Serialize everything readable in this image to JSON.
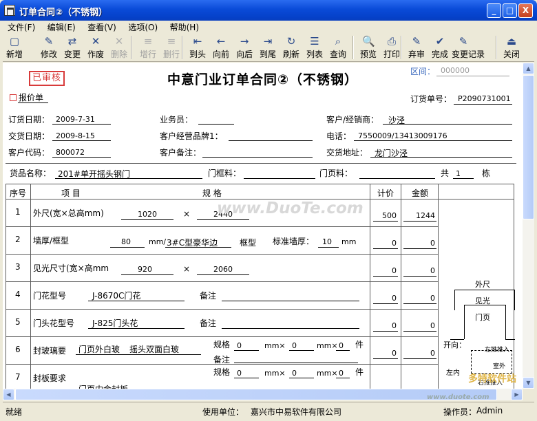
{
  "window": {
    "title": "订单合同②（不锈钢）",
    "min": "_",
    "max": "□",
    "close": "X"
  },
  "menu": [
    "文件(F)",
    "编辑(E)",
    "查看(V)",
    "选项(O)",
    "帮助(H)"
  ],
  "toolbar": [
    {
      "label": "新增",
      "icon": "new-doc-icon",
      "enabled": true
    },
    {
      "label": "修改",
      "icon": "edit-icon",
      "enabled": true
    },
    {
      "label": "变更",
      "icon": "change-icon",
      "enabled": true
    },
    {
      "label": "作废",
      "icon": "void-icon",
      "enabled": true
    },
    {
      "label": "删除",
      "icon": "delete-icon",
      "enabled": false
    },
    {
      "label": "增行",
      "icon": "add-row-icon",
      "enabled": false
    },
    {
      "label": "删行",
      "icon": "delete-row-icon",
      "enabled": false
    },
    {
      "label": "到头",
      "icon": "first-icon",
      "enabled": true
    },
    {
      "label": "向前",
      "icon": "prev-icon",
      "enabled": true
    },
    {
      "label": "向后",
      "icon": "next-icon",
      "enabled": true
    },
    {
      "label": "到尾",
      "icon": "last-icon",
      "enabled": true
    },
    {
      "label": "刷新",
      "icon": "refresh-icon",
      "enabled": true
    },
    {
      "label": "列表",
      "icon": "list-icon",
      "enabled": true
    },
    {
      "label": "查询",
      "icon": "search-icon",
      "enabled": true
    },
    {
      "label": "预览",
      "icon": "preview-icon",
      "enabled": true
    },
    {
      "label": "打印",
      "icon": "print-icon",
      "enabled": true
    },
    {
      "label": "弃审",
      "icon": "unapprove-icon",
      "enabled": true
    },
    {
      "label": "完成",
      "icon": "complete-icon",
      "enabled": true
    },
    {
      "label": "变更记录",
      "icon": "change-log-icon",
      "enabled": true
    },
    {
      "label": "关闭",
      "icon": "exit-icon",
      "enabled": true
    }
  ],
  "doc": {
    "stamp": "已审核",
    "title": "中意门业订单合同②（不锈钢）",
    "quote_label": "报价单",
    "area_label": "区间：",
    "area_value": "000000",
    "order_no_label": "订货单号：",
    "order_no": "P2090731001",
    "order_date_label": "订货日期：",
    "order_date": "2009-7-31",
    "delivery_date_label": "交货日期：",
    "delivery_date": "2009-8-15",
    "customer_code_label": "客户代码：",
    "customer_code": "800072",
    "salesman_label": "业务员：",
    "salesman": "",
    "brand_label": "客户经营品牌1：",
    "brand": "",
    "cust_note_label": "客户备注：",
    "cust_note": "",
    "customer_label": "客户/经销商：",
    "customer": "沙泾",
    "phone_label": "电话：",
    "phone": "7550009/13413009176",
    "address_label": "交货地址：",
    "address": "龙门沙泾",
    "goods_label": "货品名称：",
    "goods": "201#单开摇头钢门",
    "frame_material_label": "门框料：",
    "door_panel_label": "门页料：",
    "total_label": "共",
    "total_count": "1",
    "unit_label": "栋",
    "table_headers": {
      "no": "序号",
      "item": "项  目",
      "spec": "规  格",
      "qty": "计价",
      "amount": "金额"
    },
    "rows": [
      {
        "no": "1",
        "name": "外尺(宽×总高mm)",
        "a": "1020",
        "x": "×",
        "b": "2440",
        "qty": "500",
        "amount": "1244"
      },
      {
        "no": "2",
        "name": "墙厚/框型",
        "a": "80",
        "unit1": "mm/",
        "b": "3#C型豪华边",
        "frame_type": "框型",
        "wall_label": "标准墙厚：",
        "wall": "10",
        "unit2": "mm",
        "qty": "0",
        "amount": "0"
      },
      {
        "no": "3",
        "name": "见光尺寸(宽×高mm",
        "a": "920",
        "x": "×",
        "b": "2060",
        "qty": "0",
        "amount": "0"
      },
      {
        "no": "4",
        "name": "门花型号",
        "a": "J-8670C门花",
        "note_label": "备注",
        "qty": "0",
        "amount": "0"
      },
      {
        "no": "5",
        "name": "门头花型号",
        "a": "J-825门头花",
        "note_label": "备注",
        "qty": "0",
        "amount": "0"
      },
      {
        "no": "6",
        "name": "封玻璃要",
        "a": "门页外白玻",
        "b": "摇头双面白玻",
        "spec_label": "规格",
        "s1": "0",
        "mm1": "mm×",
        "s2": "0",
        "mm2": "mm×",
        "s3": "0",
        "piece": "件",
        "note_label": "备注",
        "qty": "0",
        "amount": "0"
      },
      {
        "no": "7",
        "name": "封板要求",
        "a": "门页内金封板",
        "spec_label": "规格",
        "s1": "0",
        "mm1": "mm×",
        "s2": "0",
        "mm2": "mm×",
        "s3": "0",
        "piece": "件"
      }
    ],
    "diagram1": {
      "outer": "外尺",
      "light": "见光",
      "page": "门页"
    },
    "diagram2": {
      "direction": "开向：",
      "left_push": "左推推入",
      "left_in": "左内",
      "outer": "室外",
      "right_push": "右推推入"
    }
  },
  "watermarks": {
    "main": "www.DuoTe.com",
    "logo": "多特软件站",
    "sub": "www.duote.com"
  },
  "status": {
    "ready": "就绪",
    "company_label": "使用单位：",
    "company": "嘉兴市中易软件有限公司",
    "operator_label": "操作员：",
    "operator": "Admin"
  }
}
